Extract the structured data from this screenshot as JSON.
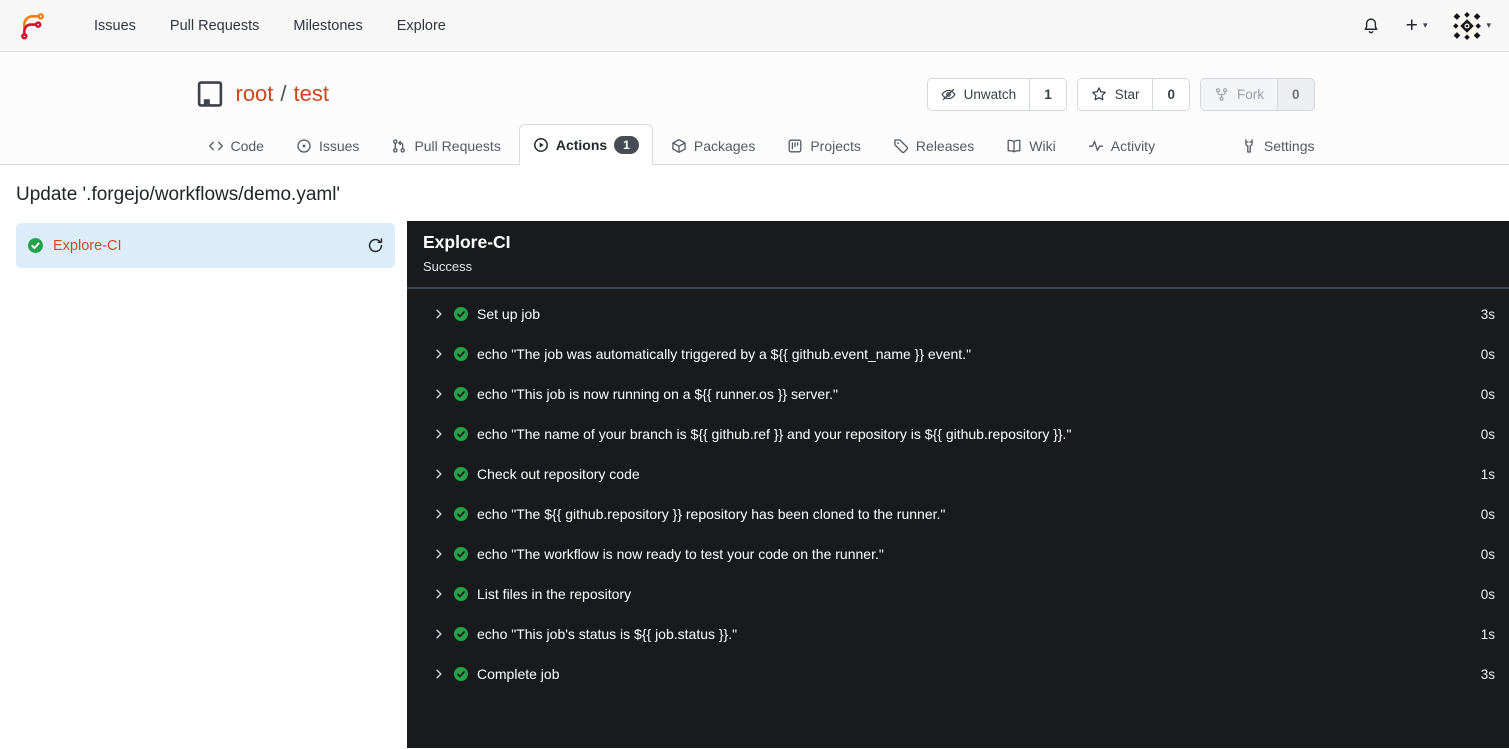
{
  "navbar": {
    "links": [
      {
        "label": "Issues"
      },
      {
        "label": "Pull Requests"
      },
      {
        "label": "Milestones"
      },
      {
        "label": "Explore"
      }
    ],
    "create_label": "+",
    "icons": {
      "logo": "forgejo-logo",
      "notifications": "bell-icon",
      "create": "plus-icon",
      "user": "avatar-identicon"
    }
  },
  "repo": {
    "owner": "root",
    "separator": "/",
    "name": "test",
    "icon": "repo-book-icon",
    "buttons": [
      {
        "label": "Unwatch",
        "count": "1",
        "icon": "eye-off-icon"
      },
      {
        "label": "Star",
        "count": "0",
        "icon": "star-icon"
      },
      {
        "label": "Fork",
        "count": "0",
        "icon": "fork-icon",
        "disabled": true
      }
    ]
  },
  "tabs": [
    {
      "label": "Code",
      "icon": "code-icon"
    },
    {
      "label": "Issues",
      "icon": "issue-circle-icon"
    },
    {
      "label": "Pull Requests",
      "icon": "pull-request-icon"
    },
    {
      "label": "Actions",
      "icon": "play-circle-icon",
      "active": true,
      "badge": "1"
    },
    {
      "label": "Packages",
      "icon": "package-icon"
    },
    {
      "label": "Projects",
      "icon": "project-board-icon"
    },
    {
      "label": "Releases",
      "icon": "tag-icon"
    },
    {
      "label": "Wiki",
      "icon": "book-open-icon"
    },
    {
      "label": "Activity",
      "icon": "pulse-icon"
    },
    {
      "label": "Settings",
      "icon": "tools-icon"
    }
  ],
  "run": {
    "commit_title": "Update '.forgejo/workflows/demo.yaml'",
    "job": {
      "name": "Explore-CI",
      "status_icon": "check-circle-icon",
      "rerun_icon": "refresh-icon"
    },
    "console": {
      "title": "Explore-CI",
      "status": "Success"
    },
    "steps": [
      {
        "name": "Set up job",
        "duration": "3s"
      },
      {
        "name": "echo \"The job was automatically triggered by a ${{ github.event_name }} event.\"",
        "duration": "0s"
      },
      {
        "name": "echo \"This job is now running on a ${{ runner.os }} server.\"",
        "duration": "0s"
      },
      {
        "name": "echo \"The name of your branch is ${{ github.ref }} and your repository is ${{ github.repository }}.\"",
        "duration": "0s"
      },
      {
        "name": "Check out repository code",
        "duration": "1s"
      },
      {
        "name": "echo \"The ${{ github.repository }} repository has been cloned to the runner.\"",
        "duration": "0s"
      },
      {
        "name": "echo \"The workflow is now ready to test your code on the runner.\"",
        "duration": "0s"
      },
      {
        "name": "List files in the repository",
        "duration": "0s"
      },
      {
        "name": "echo \"This job's status is ${{ job.status }}.\"",
        "duration": "1s"
      },
      {
        "name": "Complete job",
        "duration": "3s"
      }
    ]
  },
  "colors": {
    "accent_link": "#c8491f",
    "success_green": "#27a149",
    "console_bg": "#181a1d",
    "console_border": "#3d4754",
    "selected_job_bg": "#dbedfa",
    "badge_bg": "#474c54",
    "navbar_bg": "#f7f7f8"
  }
}
